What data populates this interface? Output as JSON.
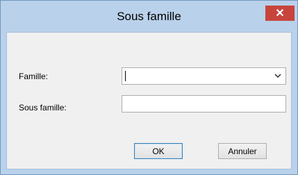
{
  "window": {
    "title": "Sous famille",
    "close_glyph": "✕"
  },
  "form": {
    "famille_label": "Famille:",
    "famille_value": "",
    "sous_famille_label": "Sous famille:",
    "sous_famille_value": ""
  },
  "buttons": {
    "ok_label": "OK",
    "cancel_label": "Annuler"
  },
  "icons": {
    "dropdown": "chevron-down-icon",
    "close": "close-icon"
  },
  "colors": {
    "frame": "#b9d1ea",
    "close_button": "#c7443c",
    "client_area": "#f0f0f0"
  }
}
